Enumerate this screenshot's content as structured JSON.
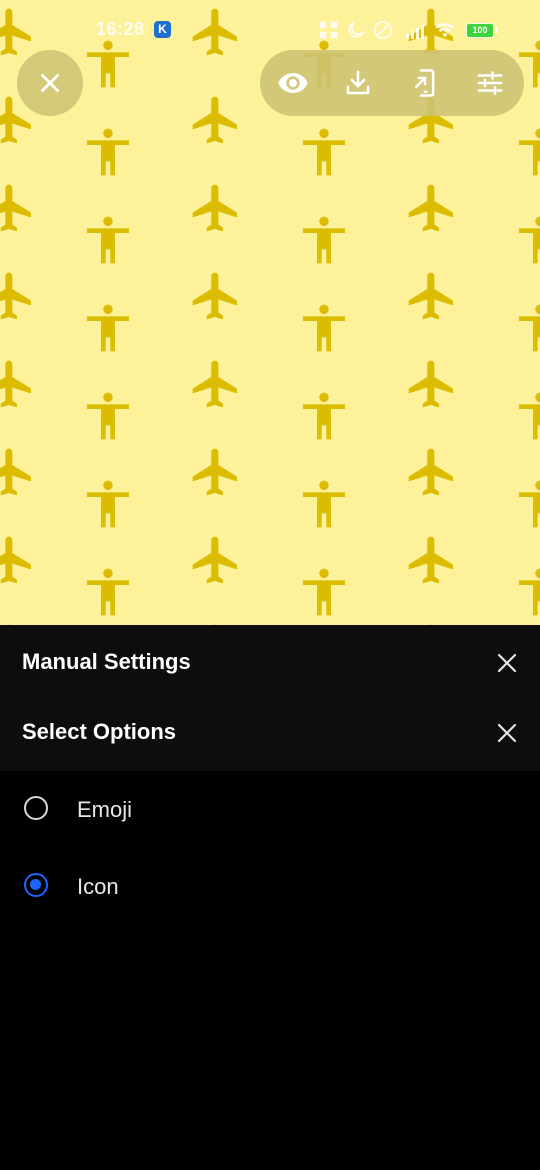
{
  "status_bar": {
    "time": "16:28",
    "app_badge": "K",
    "battery": "100"
  },
  "preview": {
    "background": "#fdf19a",
    "icon_color": "#dcbc00",
    "pattern_icons": [
      "airplane-icon",
      "accessibility-person-icon"
    ]
  },
  "top_controls": {
    "close": "close-icon",
    "tools": [
      "eye-icon",
      "download-icon",
      "set-wallpaper-icon",
      "tune-sliders-icon"
    ]
  },
  "sheet": {
    "manual_settings_title": "Manual Settings",
    "select_options_title": "Select Options",
    "options": [
      {
        "label": "Emoji",
        "selected": false
      },
      {
        "label": "Icon",
        "selected": true
      }
    ],
    "accent": "#1e62ff"
  }
}
